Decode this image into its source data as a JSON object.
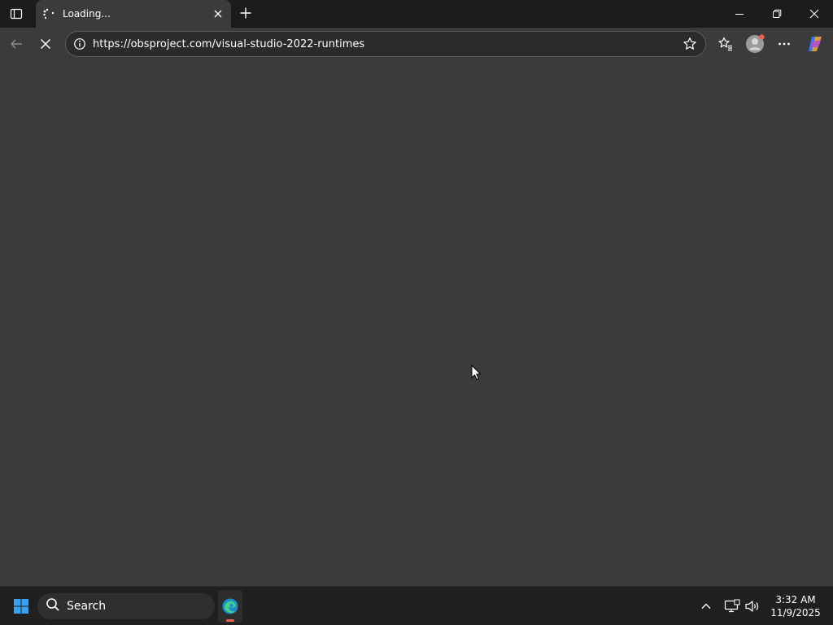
{
  "tab": {
    "title": "Loading..."
  },
  "address": {
    "url": "https://obsproject.com/visual-studio-2022-runtimes"
  },
  "taskbar": {
    "search_label": "Search",
    "time": "3:32 AM",
    "date": "11/9/2025"
  },
  "colors": {
    "chrome_bg": "#1c1c1c",
    "toolbar_bg": "#3b3b3b",
    "content_bg": "#3b3b3b",
    "taskbar_bg": "#202020",
    "profile_badge": "#e86050"
  },
  "icons": {
    "tab_actions": "tab-actions-icon",
    "loading": "loading-spinner-icon",
    "tab_close": "close-icon",
    "new_tab": "plus-icon",
    "minimize": "minimize-icon",
    "restore": "restore-icon",
    "close_window": "close-icon",
    "back": "back-arrow-icon",
    "stop": "stop-icon",
    "site_info": "info-icon",
    "favorite": "star-icon",
    "favorites": "favorites-icon",
    "profile": "profile-icon",
    "more": "more-icon",
    "copilot": "copilot-icon",
    "start": "windows-start-icon",
    "search": "search-icon",
    "edge": "edge-icon",
    "tray_overflow": "chevron-up-icon",
    "network": "network-icon",
    "volume": "volume-icon"
  }
}
